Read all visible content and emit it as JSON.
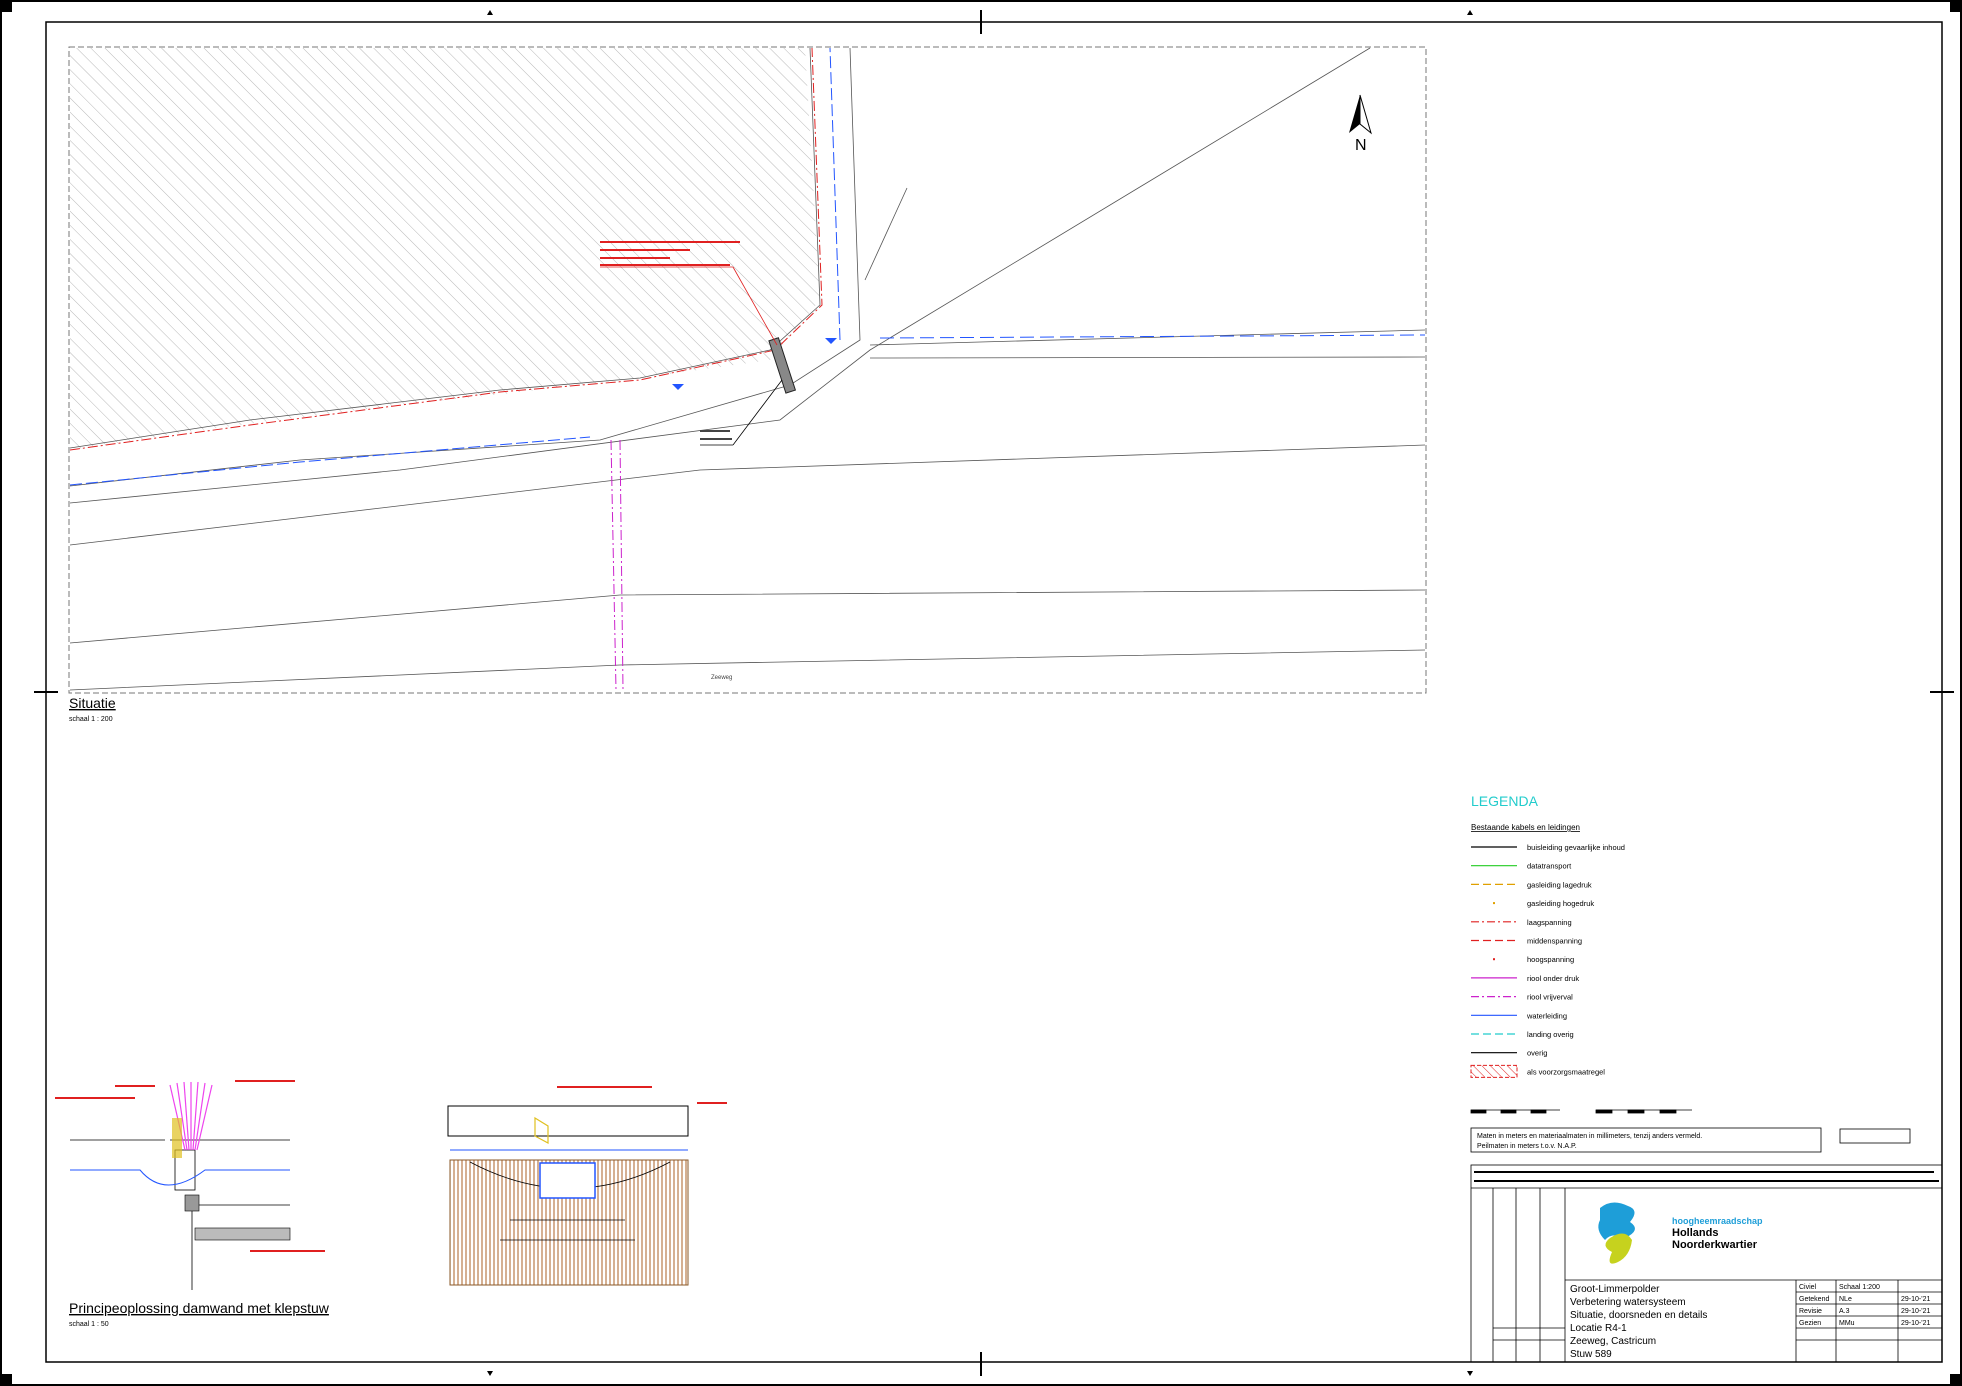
{
  "viewport": {
    "title": "Situatie",
    "scale": "schaal 1 : 200",
    "north_label": "N",
    "road_label": "Zeeweg"
  },
  "detail": {
    "title": "Principeoplossing damwand met klepstuw",
    "scale": "schaal 1 : 50"
  },
  "legend": {
    "title": "LEGENDA",
    "subtitle": "Bestaande kabels en leidingen",
    "items": [
      {
        "label": "buisleiding gevaarlijke inhoud",
        "color": "#000000",
        "style": "solid"
      },
      {
        "label": "datatransport",
        "color": "#22cc22",
        "style": "solid"
      },
      {
        "label": "gasleiding lagedruk",
        "color": "#e0a000",
        "style": "dashed"
      },
      {
        "label": "gasleiding hogedruk",
        "color": "#e0a000",
        "style": "dot"
      },
      {
        "label": "laagspanning",
        "color": "#e02020",
        "style": "dashdot"
      },
      {
        "label": "middenspanning",
        "color": "#e02020",
        "style": "dashed"
      },
      {
        "label": "hoogspanning",
        "color": "#e02020",
        "style": "dot"
      },
      {
        "label": "riool onder druk",
        "color": "#cc22cc",
        "style": "solid"
      },
      {
        "label": "riool vrijverval",
        "color": "#cc22cc",
        "style": "dashdot"
      },
      {
        "label": "waterleiding",
        "color": "#2255ff",
        "style": "solid"
      },
      {
        "label": "landing overig",
        "color": "#22cccc",
        "style": "dashed"
      },
      {
        "label": "overig",
        "color": "#000000",
        "style": "solid"
      },
      {
        "label": "als voorzorgsmaatregel",
        "color": "#e02020",
        "style": "hatch"
      }
    ]
  },
  "notes": {
    "line1": "Maten in meters en materiaalmaten in millimeters, tenzij anders vermeld.",
    "line2": "Peilmaten in meters t.o.v. N.A.P."
  },
  "title_block": {
    "org_line1": "hoogheemraadschap",
    "org_line2": "Hollands",
    "org_line3": "Noorderkwartier",
    "project_line1": "Groot-Limmerpolder",
    "project_line2": "Verbetering watersysteem",
    "project_line3": "Situatie, doorsneden en details",
    "project_line4": "Locatie R4-1",
    "project_line5": "Zeeweg, Castricum",
    "project_line6": "Stuw 589",
    "rows": [
      {
        "key": "Civiel",
        "value": "Schaal 1:200",
        "date": ""
      },
      {
        "key": "Getekend",
        "value": "NLe",
        "date": "29-10-'21"
      },
      {
        "key": "Revisie",
        "value": "A.3",
        "date": "29-10-'21"
      },
      {
        "key": "Gezien",
        "value": "MMu",
        "date": "29-10-'21"
      }
    ]
  }
}
